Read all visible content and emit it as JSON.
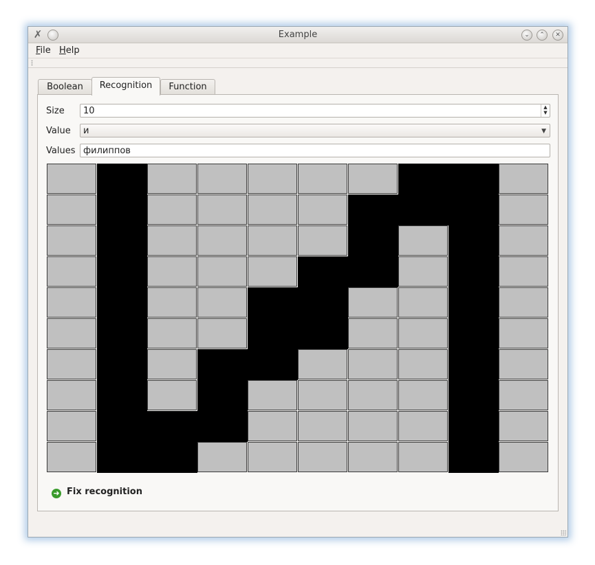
{
  "window": {
    "title": "Example",
    "controls": [
      "chevron-down-icon",
      "chevron-up-icon",
      "close-icon"
    ]
  },
  "menu": {
    "file": {
      "accel": "F",
      "rest": "ile"
    },
    "help": {
      "accel": "H",
      "rest": "elp"
    }
  },
  "tabs": [
    {
      "label": "Boolean"
    },
    {
      "label": "Recognition"
    },
    {
      "label": "Function"
    }
  ],
  "active_tab": "Recognition",
  "form": {
    "size_label": "Size",
    "size_value": "10",
    "value_label": "Value",
    "value_selected": "и",
    "values_label": "Values",
    "values_text": "филиппов"
  },
  "grid": {
    "rows": 10,
    "cols": 10,
    "cells": [
      [
        0,
        1,
        0,
        0,
        0,
        0,
        0,
        1,
        1,
        0
      ],
      [
        0,
        1,
        0,
        0,
        0,
        0,
        1,
        1,
        1,
        0
      ],
      [
        0,
        1,
        0,
        0,
        0,
        0,
        1,
        0,
        1,
        0
      ],
      [
        0,
        1,
        0,
        0,
        0,
        1,
        1,
        0,
        1,
        0
      ],
      [
        0,
        1,
        0,
        0,
        1,
        1,
        0,
        0,
        1,
        0
      ],
      [
        0,
        1,
        0,
        0,
        1,
        1,
        0,
        0,
        1,
        0
      ],
      [
        0,
        1,
        0,
        1,
        1,
        0,
        0,
        0,
        1,
        0
      ],
      [
        0,
        1,
        0,
        1,
        0,
        0,
        0,
        0,
        1,
        0
      ],
      [
        0,
        1,
        1,
        1,
        0,
        0,
        0,
        0,
        1,
        0
      ],
      [
        0,
        1,
        1,
        0,
        0,
        0,
        0,
        0,
        1,
        0
      ]
    ]
  },
  "fix_button": {
    "label": "Fix recognition",
    "icon": "arrow-right-circle-icon"
  }
}
